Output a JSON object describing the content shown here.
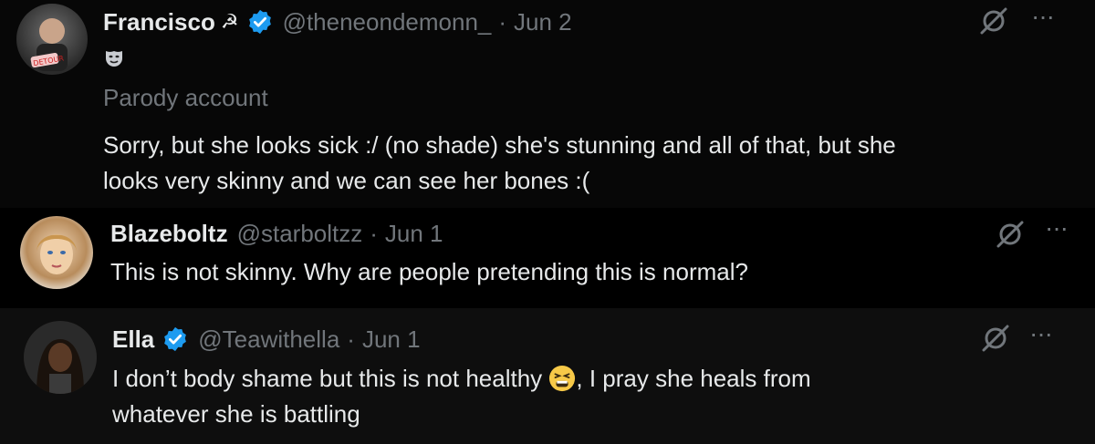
{
  "tweets": [
    {
      "display_name": "Francisco",
      "name_emoji": "☭",
      "verified": true,
      "handle": "@theneondemonn_",
      "separator": "·",
      "date": "Jun 2",
      "profile_emoji_icon": "performing-arts-mask-icon",
      "label": "Parody account",
      "text": "Sorry, but she looks sick :/ (no shade) she's stunning and all of that, but she\nlooks very skinny and we can see her bones :("
    },
    {
      "display_name": "Blazeboltz",
      "verified": false,
      "handle": "@starboltzz",
      "separator": "·",
      "date": "Jun 1",
      "text": "This is not skinny. Why are people pretending this is normal?"
    },
    {
      "display_name": "Ella",
      "verified": true,
      "handle": "@Teawithella",
      "separator": "·",
      "date": "Jun 1",
      "text_before_emoji": "I don’t body shame but this is not healthy ",
      "inline_emoji_icon": "tired-face-emoji-icon",
      "text_after_emoji": ", I pray she heals from\nwhatever she is battling"
    }
  ],
  "actions": {
    "grok_icon": "grok-icon",
    "more_label": "···"
  },
  "colors": {
    "background": "#000000",
    "text_primary": "#e7e9ea",
    "text_secondary": "#71767b",
    "verified_blue": "#1d9bf0"
  }
}
